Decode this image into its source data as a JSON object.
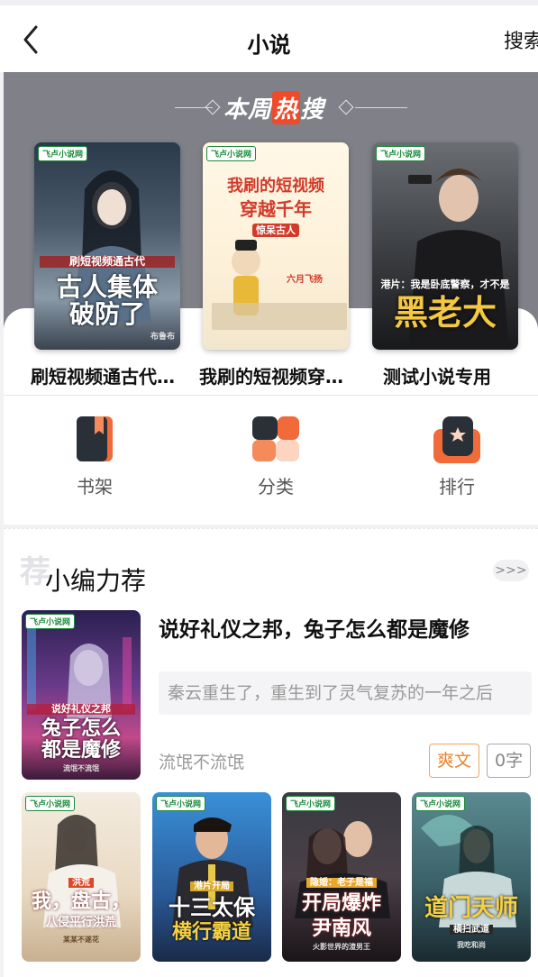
{
  "header": {
    "title": "小说",
    "search_label": "搜索"
  },
  "hot": {
    "title_prefix": "本周",
    "title_hot": "热",
    "title_suffix": "搜",
    "books": [
      {
        "title": "刷短视频通古代，古人集体破防了",
        "cover_lines": [
          "刷短视频通古代",
          "古人集体",
          "破防了"
        ],
        "cover_author": "布鲁布",
        "publisher": "飞卢小说网"
      },
      {
        "title": "我刷的短视频穿越千年",
        "cover_lines": [
          "我刷的短视频",
          "穿越千年",
          "惊呆古人"
        ],
        "cover_author": "六月飞扬",
        "publisher": "飞卢小说网"
      },
      {
        "title": "测试小说专用",
        "cover_lines": [
          "港片：我是卧底警察，才不是",
          "黑老大"
        ],
        "cover_author": "",
        "publisher": "飞卢小说网"
      }
    ]
  },
  "nav": [
    {
      "label": "书架",
      "icon": "bookshelf-icon"
    },
    {
      "label": "分类",
      "icon": "category-icon"
    },
    {
      "label": "排行",
      "icon": "ranking-icon"
    }
  ],
  "editor": {
    "watermark": "荐",
    "title": "小编力荐",
    "more_label": ">>>",
    "featured": {
      "title": "说好礼仪之邦，兔子怎么都是魔修",
      "description": "秦云重生了，重生到了灵气复苏的一年之后",
      "author": "流氓不流氓",
      "tag": "爽文",
      "word_count": "0字",
      "cover_lines": [
        "说好礼仪之邦",
        "兔子怎么",
        "都是魔修"
      ],
      "cover_author": "流氓不流氓"
    },
    "row": [
      {
        "cover_lines": [
          "洪荒",
          "我，盘古，",
          "八侵平行洪荒"
        ],
        "cover_author": "某某不遂花"
      },
      {
        "cover_lines": [
          "港片开局",
          "十三太保",
          "横行霸道"
        ],
        "cover_author": ""
      },
      {
        "cover_lines": [
          "隐婚：老子是福",
          "开局爆炸",
          "尹南风"
        ],
        "cover_author": "火影世界的渣男王"
      },
      {
        "cover_lines": [
          "道门天师",
          "横扫武道"
        ],
        "cover_author": "我吃和尚"
      }
    ]
  },
  "colors": {
    "accent": "#f04a2a",
    "tag": "#e8862f",
    "panel": "#7f8088"
  }
}
